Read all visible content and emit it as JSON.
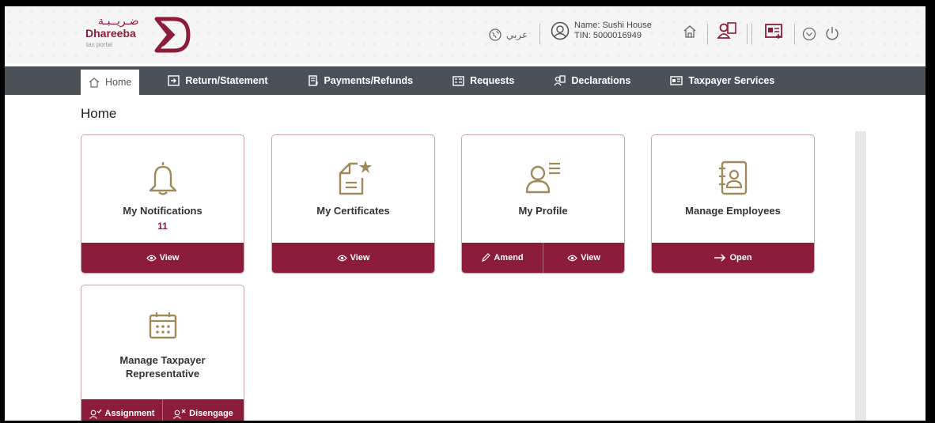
{
  "brand": {
    "arabic": "ضـريــبـة",
    "name": "Dhareeba",
    "tagline": "tax portal"
  },
  "header": {
    "language": "عربي",
    "user_name": "Name: Sushi House",
    "user_tin": "TIN: 5000016949"
  },
  "nav": [
    {
      "label": "Home",
      "icon": "home-icon"
    },
    {
      "label": "Return/Statement",
      "icon": "return-icon"
    },
    {
      "label": "Payments/Refunds",
      "icon": "payments-icon"
    },
    {
      "label": "Requests",
      "icon": "requests-icon"
    },
    {
      "label": "Declarations",
      "icon": "declarations-icon"
    },
    {
      "label": "Taxpayer Services",
      "icon": "taxpayer-services-icon"
    }
  ],
  "page": {
    "title": "Home"
  },
  "cards": {
    "notifications": {
      "title": "My Notifications",
      "count": "11",
      "actions": [
        "View"
      ]
    },
    "certificates": {
      "title": "My Certificates",
      "actions": [
        "View"
      ]
    },
    "profile": {
      "title": "My Profile",
      "actions": [
        "Amend",
        "View"
      ]
    },
    "employees": {
      "title": "Manage Employees",
      "actions": [
        "Open"
      ]
    },
    "representative": {
      "title_line1": "Manage Taxpayer",
      "title_line2": "Representative",
      "actions": [
        "Assignment",
        "Disengage"
      ]
    }
  },
  "colors": {
    "brand": "#8b1d3a",
    "nav_bg": "#4a5258",
    "icon_gold": "#a08a5c"
  }
}
